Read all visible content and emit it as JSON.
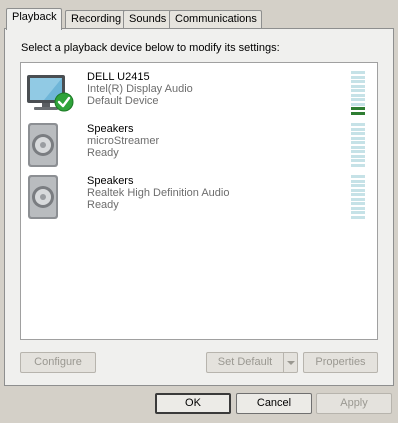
{
  "tabs": [
    {
      "label": "Playback",
      "active": true
    },
    {
      "label": "Recording",
      "active": false
    },
    {
      "label": "Sounds",
      "active": false
    },
    {
      "label": "Communications",
      "active": false
    }
  ],
  "instruction": "Select a playback device below to modify its settings:",
  "devices": [
    {
      "name": "DELL U2415",
      "driver": "Intel(R) Display Audio",
      "status": "Default Device",
      "icon": "monitor-icon",
      "is_default": true,
      "meter_level": 0.2
    },
    {
      "name": "Speakers",
      "driver": "microStreamer",
      "status": "Ready",
      "icon": "speaker-icon",
      "is_default": false,
      "meter_level": 0
    },
    {
      "name": "Speakers",
      "driver": "Realtek High Definition Audio",
      "status": "Ready",
      "icon": "speaker-icon",
      "is_default": false,
      "meter_level": 0
    }
  ],
  "buttons": {
    "configure": "Configure",
    "set_default": "Set Default",
    "properties": "Properties",
    "ok": "OK",
    "cancel": "Cancel",
    "apply": "Apply"
  },
  "colors": {
    "window_bg": "#d4d0c8",
    "panel_bg": "#f0f0ee",
    "meter_off": "#c6e2e7",
    "meter_on": "#2e7d32",
    "check_green": "#2fa33a",
    "disabled_text": "#9a9891"
  }
}
